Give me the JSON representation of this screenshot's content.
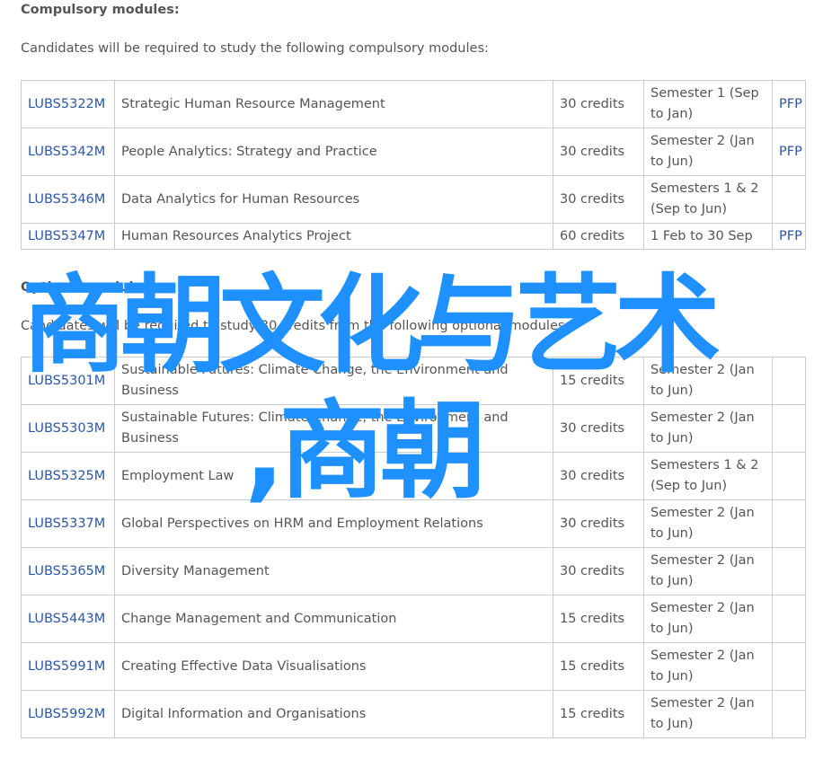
{
  "compulsory": {
    "heading": "Compulsory modules:",
    "intro": "Candidates will be required to study the following compulsory modules:",
    "rows": [
      {
        "code": "LUBS5322M",
        "title": "Strategic Human Resource Management",
        "credits": "30 credits",
        "semester": "Semester 1 (Sep to Jan)",
        "pfp": "PFP"
      },
      {
        "code": "LUBS5342M",
        "title": "People Analytics: Strategy and Practice",
        "credits": "30 credits",
        "semester": "Semester 2 (Jan to Jun)",
        "pfp": "PFP"
      },
      {
        "code": "LUBS5346M",
        "title": "Data Analytics for Human Resources",
        "credits": "30 credits",
        "semester": "Semesters 1 & 2 (Sep to Jun)",
        "pfp": ""
      },
      {
        "code": "LUBS5347M",
        "title": "Human Resources Analytics Project",
        "credits": "60 credits",
        "semester": "1 Feb to 30 Sep",
        "pfp": "PFP"
      }
    ]
  },
  "optional": {
    "heading": "Optional modules:",
    "intro": "Candidates will be required to study 30 credits from the following optional modules",
    "rows": [
      {
        "code": "LUBS5301M",
        "title": "Sustainable Futures: Climate Change, the Environment and Business",
        "credits": "15 credits",
        "semester": "Semester 2 (Jan to Jun)",
        "pfp": ""
      },
      {
        "code": "LUBS5303M",
        "title": "Sustainable Futures: Climate Change, the Environment and Business",
        "credits": "30 credits",
        "semester": "Semester 2 (Jan to Jun)",
        "pfp": ""
      },
      {
        "code": "LUBS5325M",
        "title": "Employment Law",
        "credits": "30 credits",
        "semester": "Semesters 1 & 2 (Sep to Jun)",
        "pfp": ""
      },
      {
        "code": "LUBS5337M",
        "title": "Global Perspectives on HRM and Employment Relations",
        "credits": "30 credits",
        "semester": "Semester 2 (Jan to Jun)",
        "pfp": ""
      },
      {
        "code": "LUBS5365M",
        "title": "Diversity Management",
        "credits": "30 credits",
        "semester": "Semester 2 (Jan to Jun)",
        "pfp": ""
      },
      {
        "code": "LUBS5443M",
        "title": "Change Management and Communication",
        "credits": "15 credits",
        "semester": "Semester 2 (Jan to Jun)",
        "pfp": ""
      },
      {
        "code": "LUBS5991M",
        "title": "Creating Effective Data Visualisations",
        "credits": "15 credits",
        "semester": "Semester 2 (Jan to Jun)",
        "pfp": ""
      },
      {
        "code": "LUBS5992M",
        "title": "Digital Information and Organisations",
        "credits": "15 credits",
        "semester": "Semester 2 (Jan to Jun)",
        "pfp": ""
      }
    ]
  },
  "overlay": {
    "line1": "商朝文化与艺术",
    "line2": ",商朝",
    "color": "#1e90ff"
  },
  "colors": {
    "link": "#2b57a5",
    "text": "#555555",
    "border": "#cccccc"
  }
}
